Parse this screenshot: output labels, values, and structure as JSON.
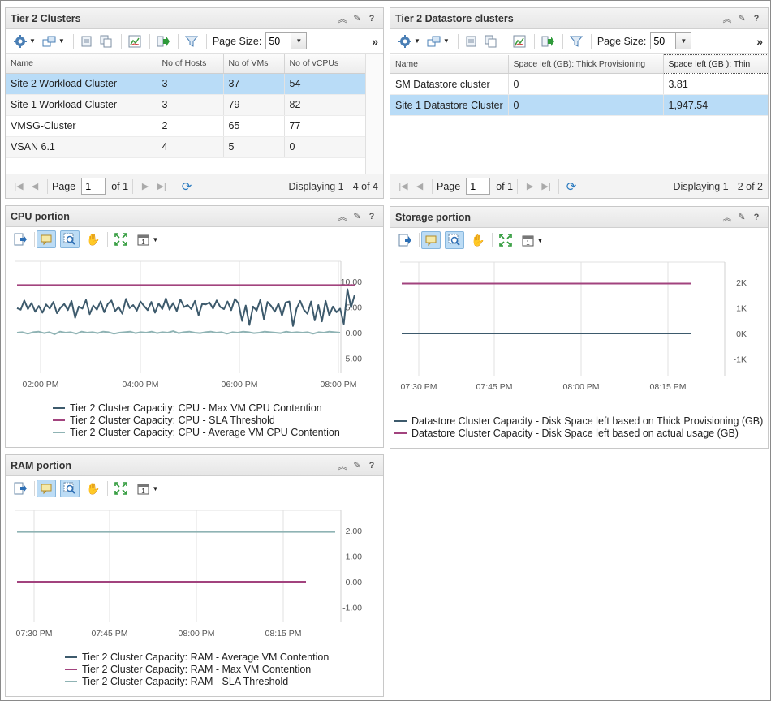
{
  "clusters_panel": {
    "title": "Tier 2 Clusters",
    "page_size_label": "Page Size:",
    "page_size": "50",
    "columns": [
      "Name",
      "No of Hosts",
      "No of VMs",
      "No of vCPUs"
    ],
    "rows": [
      [
        "Site 2 Workload Cluster",
        "3",
        "37",
        "54"
      ],
      [
        "Site 1 Workload Cluster",
        "3",
        "79",
        "82"
      ],
      [
        "VMSG-Cluster",
        "2",
        "65",
        "77"
      ],
      [
        "VSAN 6.1",
        "4",
        "5",
        "0"
      ]
    ],
    "selected_row": 0,
    "pager": {
      "page_label": "Page",
      "page": "1",
      "of": "of 1",
      "displaying": "Displaying 1 - 4 of 4"
    }
  },
  "datastore_panel": {
    "title": "Tier 2 Datastore clusters",
    "page_size_label": "Page Size:",
    "page_size": "50",
    "columns": [
      "Name",
      "Space left (GB): Thick Provisioning",
      "Space left (GB ): Thin"
    ],
    "rows": [
      [
        "SM Datastore cluster",
        "0",
        "3.81"
      ],
      [
        "Site 1 Datastore Cluster",
        "0",
        "1,947.54"
      ]
    ],
    "selected_row": 1,
    "pager": {
      "page_label": "Page",
      "page": "1",
      "of": "of 1",
      "displaying": "Displaying 1 - 2 of 2"
    }
  },
  "cpu_panel": {
    "title": "CPU portion",
    "chart_data": {
      "type": "line",
      "x_ticks": [
        "02:00 PM",
        "04:00 PM",
        "06:00 PM",
        "08:00 PM"
      ],
      "y_ticks": [
        "10.00",
        "5.00",
        "0.00",
        "-5.00"
      ],
      "ylim": [
        -5,
        10
      ],
      "series": [
        {
          "name": "Tier 2 Cluster Capacity: CPU - Max VM CPU Contention",
          "color": "#3d5a6c",
          "values": [
            4.8,
            4.5,
            6.3,
            4.6,
            5.8,
            4.1,
            5.2,
            3.9,
            5.5,
            4.7,
            6.0,
            3.8,
            4.9,
            5.6,
            4.4,
            6.2,
            2.9,
            5.1,
            4.7,
            6.4,
            3.6,
            5.3,
            4.5,
            6.1,
            4.0,
            5.6,
            6.3,
            4.2,
            5.0,
            3.7,
            6.6,
            4.8,
            5.4,
            4.3,
            6.1,
            5.2,
            4.4,
            6.0,
            3.9,
            5.7,
            4.6,
            6.7,
            4.5,
            5.8,
            4.2,
            6.5,
            5.0,
            5.4,
            4.6,
            6.2,
            3.4,
            5.6,
            5.5,
            5.9,
            4.7,
            6.3,
            5.0,
            4.6,
            6.1,
            4.4,
            6.6,
            5.7,
            2.3,
            5.3,
            1.5,
            5.1,
            4.3,
            6.4,
            2.6,
            6.0,
            5.2,
            4.1,
            5.7,
            3.3,
            5.9,
            6.1,
            1.3,
            4.7,
            6.2,
            4.5,
            3.7,
            6.1,
            2.4,
            5.4,
            2.2,
            6.2,
            3.4,
            5.1,
            4.0,
            4.7,
            1.7,
            8.5,
            4.9,
            7.4
          ]
        },
        {
          "name": "Tier 2 Cluster Capacity: CPU - SLA Threshold",
          "color": "#a2437e",
          "values": [
            9.3,
            9.3
          ]
        },
        {
          "name": "Tier 2 Cluster Capacity: CPU - Average VM CPU Contention",
          "color": "#8fb3b4",
          "values": [
            0.0,
            0.1,
            -0.2,
            0.1,
            0.2,
            -0.1,
            0.1,
            -0.3,
            0.2,
            0.0,
            0.1,
            -0.2,
            0.2,
            0.0,
            0.1,
            -0.1,
            0.2,
            0.1,
            -0.2,
            0.0,
            0.1,
            0.2,
            -0.1,
            0.1,
            0.0,
            0.2,
            -0.1,
            0.1,
            0.0,
            0.3,
            -0.1,
            0.1,
            0.2,
            0.0,
            -0.1,
            0.1,
            0.2,
            0.0,
            0.1,
            -0.2,
            0.1,
            0.0,
            0.2,
            0.1,
            -0.1,
            0.0,
            0.2,
            0.1,
            0.0,
            -0.1,
            0.2,
            0.0,
            0.1,
            0.0,
            0.1,
            -0.2,
            0.1,
            0.0,
            0.2,
            0.1,
            0.0
          ]
        }
      ]
    }
  },
  "storage_panel": {
    "title": "Storage portion",
    "chart_data": {
      "type": "line",
      "x_ticks": [
        "07:30 PM",
        "07:45 PM",
        "08:00 PM",
        "08:15 PM"
      ],
      "y_ticks": [
        "2K",
        "1K",
        "0K",
        "-1K"
      ],
      "ylim": [
        -1000,
        2000
      ],
      "series": [
        {
          "name": "Datastore Cluster Capacity - Disk Space left based on Thick Provisioning (GB)",
          "color": "#3d5a6c",
          "values": [
            0,
            0
          ]
        },
        {
          "name": "Datastore Cluster Capacity - Disk Space left based on actual usage (GB)",
          "color": "#a2437e",
          "values": [
            1951,
            1951
          ]
        }
      ]
    }
  },
  "ram_panel": {
    "title": "RAM portion",
    "chart_data": {
      "type": "line",
      "x_ticks": [
        "07:30 PM",
        "07:45 PM",
        "08:00 PM",
        "08:15 PM"
      ],
      "y_ticks": [
        "2.00",
        "1.00",
        "0.00",
        "-1.00"
      ],
      "ylim": [
        -1,
        2
      ],
      "series": [
        {
          "name": "Tier 2 Cluster Capacity: RAM - Average VM Contention",
          "color": "#3d5a6c",
          "values": [
            0,
            0
          ]
        },
        {
          "name": "Tier 2 Cluster Capacity: RAM - Max VM Contention",
          "color": "#a2437e",
          "values": [
            0,
            0
          ]
        },
        {
          "name": "Tier 2 Cluster Capacity: RAM - SLA Threshold",
          "color": "#8fb3b4",
          "values": [
            1.95,
            1.95
          ]
        }
      ]
    }
  },
  "icons": {
    "header": [
      "collapse-icon",
      "edit-icon",
      "help-icon"
    ],
    "list_toolbar": [
      "settings-icon",
      "navigate-icon",
      "export-icon",
      "copy-icon",
      "chart-icon",
      "export-data-icon",
      "filter-icon"
    ],
    "chart_toolbar": [
      "save-image-icon",
      "tooltip-toggle-icon",
      "zoom-icon",
      "pan-icon",
      "fit-all-icon",
      "date-range-icon"
    ]
  }
}
